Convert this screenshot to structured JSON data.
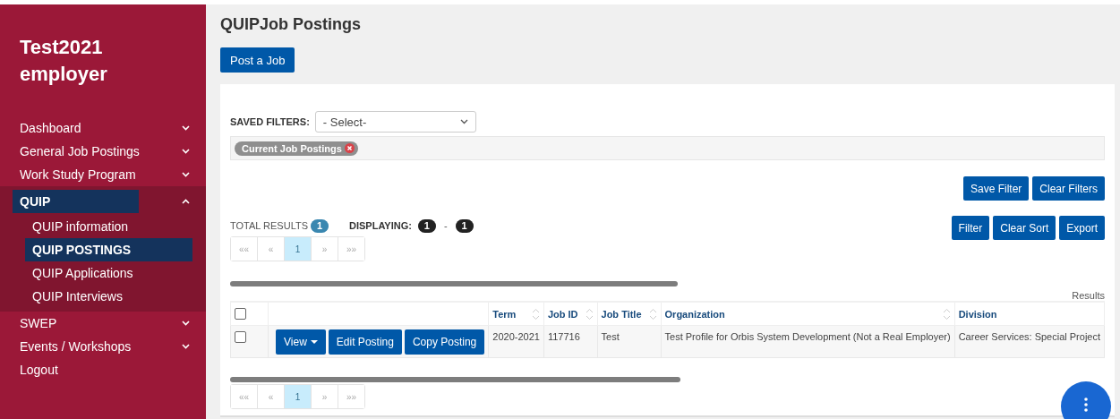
{
  "sidebar": {
    "title": "Test2021 employer",
    "items": [
      {
        "label": "Dashboard",
        "kind": "group",
        "expanded": false,
        "selected": false
      },
      {
        "label": "General Job Postings",
        "kind": "group",
        "expanded": false,
        "selected": false
      },
      {
        "label": "Work Study Program",
        "kind": "group",
        "expanded": false,
        "selected": false
      },
      {
        "label": "QUIP",
        "kind": "group",
        "expanded": true,
        "selected": true,
        "children": [
          {
            "label": "QUIP information",
            "selected": false
          },
          {
            "label": "QUIP POSTINGS",
            "selected": true
          },
          {
            "label": "QUIP Applications",
            "selected": false
          },
          {
            "label": "QUIP Interviews",
            "selected": false
          }
        ]
      },
      {
        "label": "SWEP",
        "kind": "group",
        "expanded": false,
        "selected": false
      },
      {
        "label": "Events / Workshops",
        "kind": "group",
        "expanded": false,
        "selected": false
      },
      {
        "label": "Logout",
        "kind": "link",
        "selected": false
      }
    ]
  },
  "page_title": "QUIPJob Postings",
  "post_button": "Post a Job",
  "filters": {
    "saved_label": "SAVED FILTERS:",
    "select_value": "- Select-",
    "chips": [
      {
        "label": "Current Job Postings"
      }
    ],
    "buttons": [
      "Save Filter",
      "Clear Filters"
    ]
  },
  "results": {
    "total_label": "TOTAL RESULTS",
    "total": "1",
    "displaying_label": "DISPLAYING:",
    "from": "1",
    "separator": "-",
    "to": "1",
    "buttons": [
      "Filter",
      "Clear Sort",
      "Export"
    ]
  },
  "pagination_top": [
    {
      "label": "««",
      "selected": false
    },
    {
      "label": "«",
      "selected": false
    },
    {
      "label": "1",
      "selected": true
    },
    {
      "label": "»",
      "selected": false
    },
    {
      "label": "»»",
      "selected": false
    }
  ],
  "results_label": "Results",
  "table": {
    "select_all_checked": false,
    "columns": [
      {
        "kind": "text",
        "label": "Term",
        "sortable": true
      },
      {
        "kind": "text",
        "label": "Job ID",
        "sortable": true
      },
      {
        "kind": "text",
        "label": "Job Title",
        "sortable": true
      },
      {
        "kind": "text",
        "label": "Organization",
        "sortable": true
      },
      {
        "kind": "text",
        "label": "Division",
        "sortable": false
      }
    ],
    "rows": [
      {
        "checked": false,
        "actions": [
          {
            "label": "View",
            "dropdown": true
          },
          {
            "label": "Edit Posting",
            "dropdown": false
          },
          {
            "label": "Copy Posting",
            "dropdown": false
          }
        ],
        "cells": [
          "2020-2021",
          "117716",
          "Test",
          "Test Profile for Orbis System Development (Not a Real Employer)",
          "Career Services: Special Project"
        ]
      }
    ]
  },
  "pagination_bottom": [
    {
      "label": "««",
      "selected": false
    },
    {
      "label": "«",
      "selected": false
    },
    {
      "label": "1",
      "selected": true
    },
    {
      "label": "»",
      "selected": false
    },
    {
      "label": "»»",
      "selected": false
    }
  ]
}
